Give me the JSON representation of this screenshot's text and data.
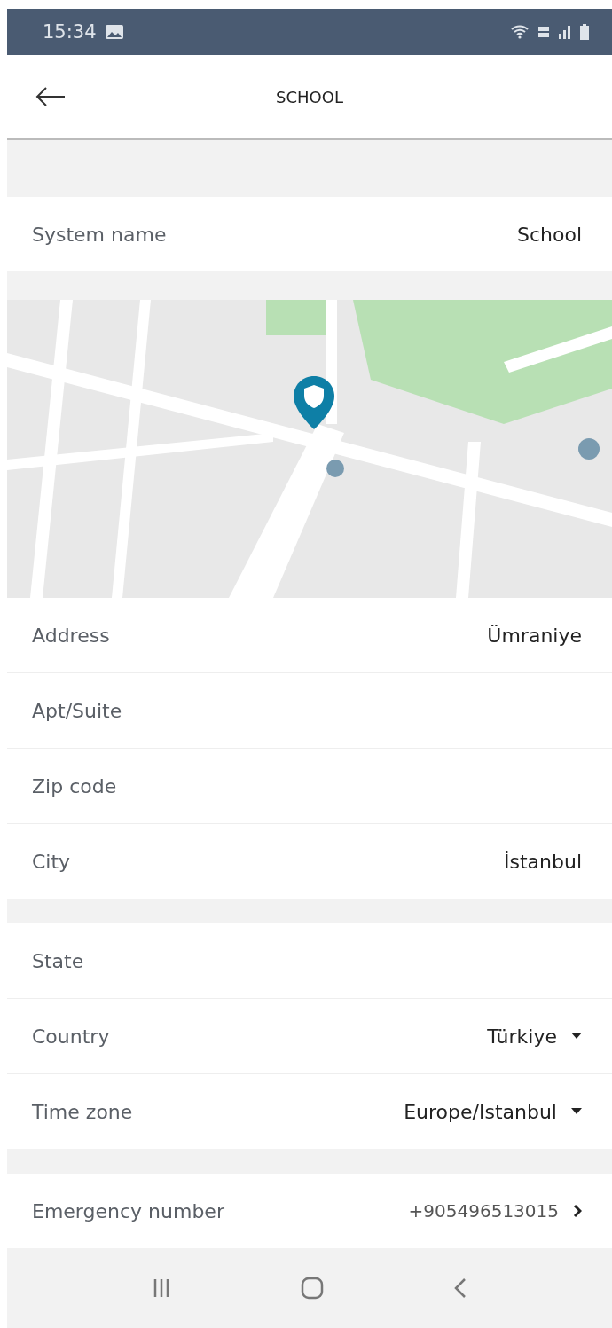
{
  "status_bar": {
    "time": "15:34"
  },
  "header": {
    "title": "SCHOOL"
  },
  "sections": [
    {
      "kind": "list",
      "rows": [
        {
          "kind": "plain",
          "label": "System name",
          "value": "School"
        }
      ]
    },
    {
      "kind": "map"
    },
    {
      "kind": "list",
      "rows": [
        {
          "kind": "plain",
          "label": "Address",
          "value": "Ümraniye"
        },
        {
          "kind": "plain",
          "label": "Apt/Suite"
        },
        {
          "kind": "plain",
          "label": "Zip code"
        },
        {
          "kind": "plain",
          "label": "City",
          "value": "İstanbul"
        }
      ]
    },
    {
      "kind": "list",
      "rows": [
        {
          "kind": "plain",
          "label": "State"
        },
        {
          "kind": "dropdown",
          "label": "Country",
          "value": "Türkiye"
        },
        {
          "kind": "dropdown",
          "label": "Time zone",
          "value": "Europe/Istanbul"
        }
      ]
    },
    {
      "kind": "list",
      "rows": [
        {
          "kind": "link",
          "label": "Emergency number",
          "value": "+905496513015"
        }
      ]
    }
  ]
}
